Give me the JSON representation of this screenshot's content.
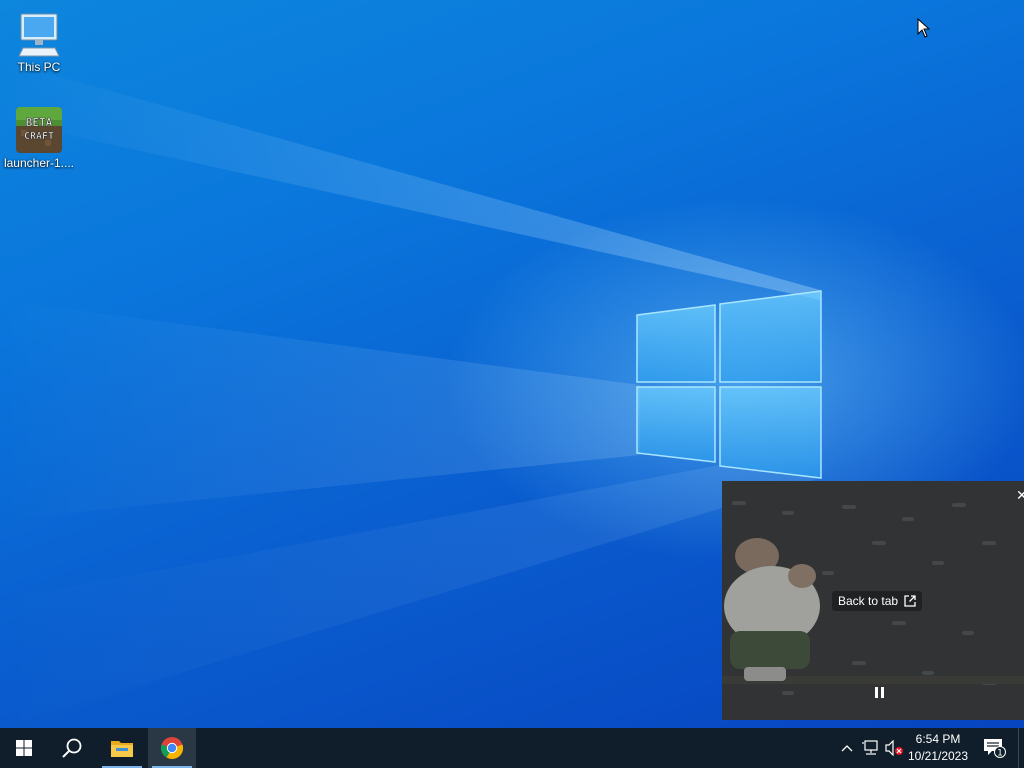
{
  "desktop": {
    "icons": [
      {
        "label": "This PC",
        "icon": "computer-icon"
      },
      {
        "label": "launcher-1....",
        "icon": "betacraft-icon",
        "badge_text": "BETA CRAFT"
      }
    ]
  },
  "pip": {
    "back_to_tab_label": "Back to tab",
    "close_icon": "close-icon",
    "pause_icon": "pause-icon",
    "open-tab-icon": "external-link-icon"
  },
  "taskbar": {
    "start_icon": "windows-logo-icon",
    "search_icon": "search-icon",
    "pinned": [
      {
        "name": "File Explorer",
        "icon": "folder-icon"
      },
      {
        "name": "Google Chrome",
        "icon": "chrome-icon"
      }
    ],
    "tray": {
      "show_hidden_icon": "chevron-up-icon",
      "network_icon": "network-icon",
      "volume_icon": "volume-muted-icon"
    },
    "clock": {
      "time": "6:54 PM",
      "date": "10/21/2023"
    },
    "notifications": {
      "icon": "notification-icon",
      "count": "1"
    }
  },
  "colors": {
    "taskbar": "#101e2b",
    "wallpaper_blue": "#0a76dc",
    "accent": "#7ab4e8"
  }
}
